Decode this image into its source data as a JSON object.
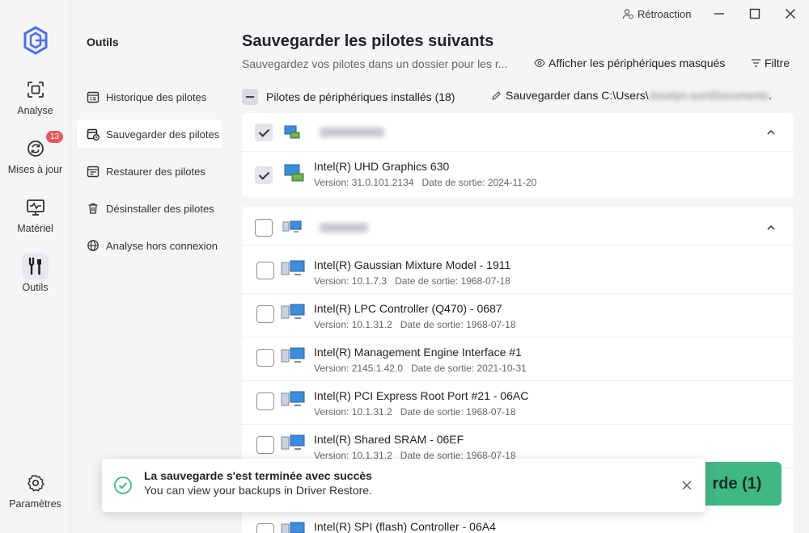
{
  "rail": {
    "items": [
      {
        "label": "Analyse",
        "icon": "scan-icon"
      },
      {
        "label": "Mises à jour",
        "icon": "refresh-icon",
        "badge": "13"
      },
      {
        "label": "Matériel",
        "icon": "monitor-pulse-icon"
      },
      {
        "label": "Outils",
        "icon": "tools-icon"
      }
    ],
    "settings_label": "Paramètres"
  },
  "tools": {
    "title": "Outils",
    "items": [
      {
        "label": "Historique des pilotes"
      },
      {
        "label": "Sauvegarder des pilotes"
      },
      {
        "label": "Restaurer des pilotes"
      },
      {
        "label": "Désinstaller des pilotes"
      },
      {
        "label": "Analyse hors connexion"
      }
    ]
  },
  "window": {
    "feedback_label": "Rétroaction"
  },
  "main": {
    "title": "Sauvegarder les pilotes suivants",
    "subtitle": "Sauvegardez vos pilotes dans un dossier pour les r...",
    "show_hidden_label": "Afficher les périphériques masqués",
    "filter_label": "Filtre",
    "installed_label": "Pilotes de périphériques installés (18)",
    "save_in_label": "Sauvegarder dans C:\\Users\\",
    "save_in_path_blurred": "Jocelyn.sun\\Documents",
    "save_in_suffix": "."
  },
  "groups": [
    {
      "checked": true,
      "drivers": [
        {
          "name": "Intel(R) UHD Graphics 630",
          "version": "Version: 31.0.101.2134",
          "date": "Date de sortie: 2024-11-20",
          "checked": true
        }
      ]
    },
    {
      "checked": false,
      "drivers": [
        {
          "name": "Intel(R) Gaussian Mixture Model - 1911",
          "version": "Version: 10.1.7.3",
          "date": "Date de sortie: 1968-07-18",
          "checked": false
        },
        {
          "name": "Intel(R) LPC Controller (Q470) - 0687",
          "version": "Version: 10.1.31.2",
          "date": "Date de sortie: 1968-07-18",
          "checked": false
        },
        {
          "name": "Intel(R) Management Engine Interface #1",
          "version": "Version: 2145.1.42.0",
          "date": "Date de sortie: 2021-10-31",
          "checked": false
        },
        {
          "name": "Intel(R) PCI Express Root Port #21 - 06AC",
          "version": "Version: 10.1.31.2",
          "date": "Date de sortie: 1968-07-18",
          "checked": false
        },
        {
          "name": "Intel(R) Shared SRAM - 06EF",
          "version": "Version: 10.1.31.2",
          "date": "Date de sortie: 1968-07-18",
          "checked": false
        },
        {
          "name": "Intel(R) SPI (flash) Controller - 06A4",
          "version": "",
          "date": "",
          "checked": false
        }
      ]
    }
  ],
  "action": {
    "backup_button_label": "rde (1)"
  },
  "toast": {
    "title": "La sauvegarde s'est terminée avec succès",
    "message": "You can view your backups in Driver Restore."
  },
  "colors": {
    "accent": "#3fb882",
    "badge": "#f0545c",
    "logo": "#4a6cf7"
  }
}
